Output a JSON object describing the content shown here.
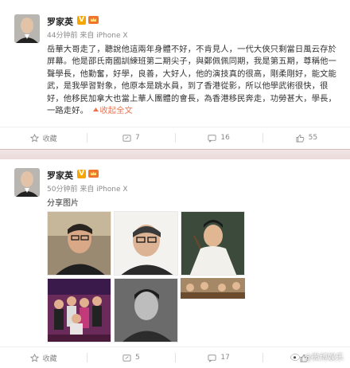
{
  "posts": [
    {
      "author": "罗家英",
      "verified_badge": "V",
      "meta": "44分钟前 来自 iPhone X",
      "text": "岳華大哥走了，聽說他這兩年身體不好，不肯見人，一代大俠只剩當日風云存於屏幕。他是邵氏南國訓練班第二期尖子，與鄭佩佩同期，我是第五期，尊稱他一聲學長，他勤奮，好學，良善，大好人，他的演技真的很高，剛柔剛好，能文能武，是我學習對象，他原本是跳水員，到了香港從影，所以他學武術很快，很好，他移民加拿大也當上華人團體的會長，為香港移民奔走，功勞甚大，學長，一路走好。",
      "expand_label": "收起全文",
      "actions": {
        "favorite": "收藏",
        "repost": "7",
        "comment": "16",
        "like": "55"
      }
    },
    {
      "author": "罗家英",
      "verified_badge": "V",
      "meta": "50分钟前 来自 iPhone X",
      "caption": "分享图片",
      "actions": {
        "favorite": "收藏",
        "repost": "5",
        "comment": "17",
        "like": ""
      }
    }
  ],
  "watermark": "@微博娱乐",
  "colors": {
    "accent": "#eb7350",
    "badge": "#f7a500",
    "divider": "#ebd8d8"
  }
}
